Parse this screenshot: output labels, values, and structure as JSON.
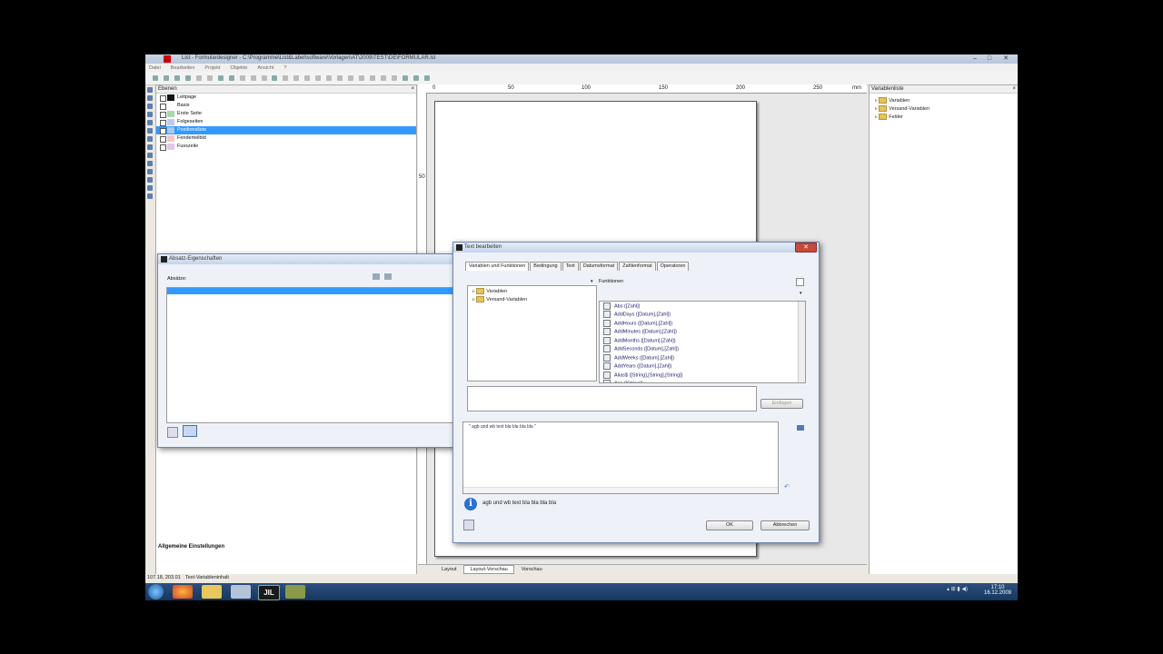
{
  "window": {
    "title": "List - Formulardesigner - C:\\Programme\\List&Label\\software\\Vorlagen\\AT\\2009\\TEST\\DE\\FORMULAR.lst",
    "minimize_label": "–",
    "maximize_label": "□",
    "close_label": "✕"
  },
  "menu": [
    "Datei",
    "Bearbeiten",
    "Projekt",
    "Objekte",
    "Ansicht",
    "?"
  ],
  "layers_panel": {
    "title": "Ebenen",
    "items": [
      {
        "label": "Leitpage",
        "color": "#111111"
      },
      {
        "label": "Basis",
        "color": "#ffffff"
      },
      {
        "label": "Erste Seite",
        "color": "#a8d8b0"
      },
      {
        "label": "Folgeseiten",
        "color": "#c5c8ee"
      },
      {
        "label": "Positionsliste",
        "color": "#a8c8ee"
      },
      {
        "label": "Fenderteilbld",
        "color": "#f5c5c5"
      },
      {
        "label": "Fusszeile",
        "color": "#e5c5ee"
      }
    ],
    "selected_index": 4,
    "bottom_title": "Allgemeine Einstellungen"
  },
  "ruler": {
    "marks": [
      "0",
      "50",
      "100",
      "150",
      "200",
      "250",
      "mm"
    ],
    "left_mark": "50"
  },
  "variable_panel": {
    "title": "Variablenliste",
    "close_label": "×",
    "items": [
      "Variablen",
      "Versand-Variablen",
      "Felder"
    ]
  },
  "absatz_dialog": {
    "title": "Absatz-Eigenschaften",
    "label": "Absätze:"
  },
  "text_dialog": {
    "title": "Text bearbeiten",
    "close_label": "✕",
    "tabs": [
      "Variablen und Funktionen",
      "Bedingung",
      "Text",
      "Datumsformat",
      "Zahlenformat",
      "Operatoren"
    ],
    "active_tab": 0,
    "tree": [
      "Variablen",
      "Versand-Variablen"
    ],
    "functions_label": "Funktionen",
    "functions": [
      "Abs ([Zahl])",
      "AddDays ([Datum],[Zahl])",
      "AddHours ([Datum],[Zahl])",
      "AddMinutes ([Datum],[Zahl])",
      "AddMonths ([Datum],[Zahl])",
      "AddSeconds ([Datum],[Zahl])",
      "AddWeeks ([Datum],[Zahl])",
      "AddYears ([Datum],[Zahl])",
      "Alias$ ([String],[String],[String])",
      "Asc ([String])"
    ],
    "insert_button": "Einfügen",
    "formula_text": "\" agb und wb text bla bla bla bla \"",
    "result_text": "agb und wb text bla bla bla bla",
    "ok_button": "OK",
    "cancel_button": "Abbrechen"
  },
  "bottom_tabs": [
    "Layout",
    "Layout-Vorschau",
    "Vorschau"
  ],
  "status": {
    "coords": "107.18, 203.01",
    "text": "Text-Variableninhalt"
  },
  "taskbar": {
    "time": "17:10",
    "date": "16.12.2009",
    "app_label": "JIL"
  }
}
